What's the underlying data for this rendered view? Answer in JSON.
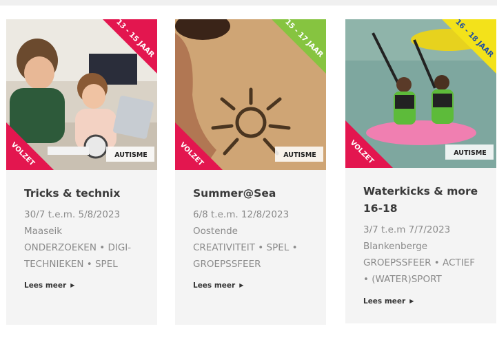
{
  "cards": [
    {
      "age": "13 - 15 JAAR",
      "status": "VOLZET",
      "logo": "AUTISME",
      "title_lines": [
        "Tricks & technix"
      ],
      "date": "30/7 t.e.m. 5/8/2023",
      "location": "Maaseik",
      "tag_lines": [
        "ONDERZOEKEN • DIGI-",
        "TECHNIEKEN • SPEL"
      ],
      "more": "Lees meer",
      "ribbon_color": "#e3164f"
    },
    {
      "age": "15 - 17 JAAR",
      "status": "VOLZET",
      "logo": "AUTISME",
      "title_lines": [
        "Summer@Sea"
      ],
      "date": "6/8 t.e.m. 12/8/2023",
      "location": "Oostende",
      "tag_lines": [
        "CREATIVITEIT • SPEL •",
        "GROEPSSFEER"
      ],
      "more": "Lees meer",
      "ribbon_color": "#86c440"
    },
    {
      "age": "16 - 18 JAAR",
      "status": "VOLZET",
      "logo": "AUTISME",
      "title_lines": [
        "Waterkicks & more",
        "16-18"
      ],
      "date": "3/7 t.e.m 7/7/2023",
      "location": "Blankenberge",
      "tag_lines": [
        "GROEPSSFEER • ACTIEF",
        "• (WATER)SPORT"
      ],
      "more": "Lees meer",
      "ribbon_color": "#f3e21a"
    }
  ]
}
